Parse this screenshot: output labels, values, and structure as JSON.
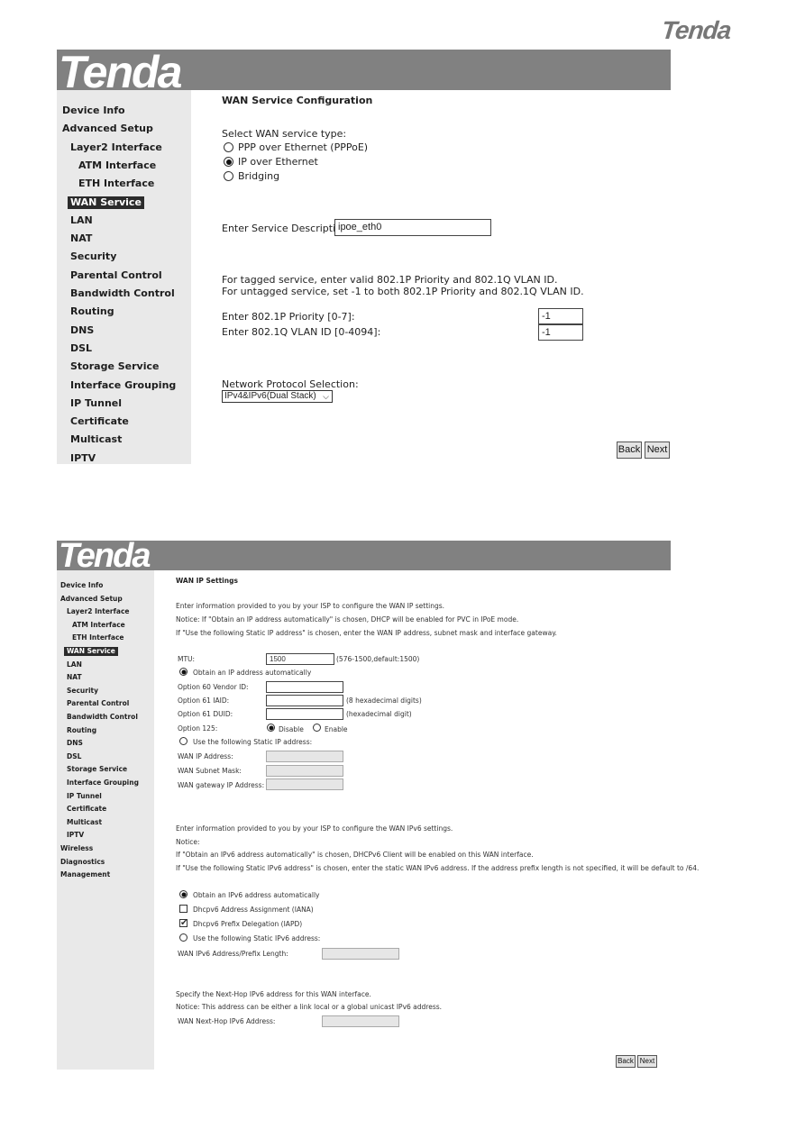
{
  "brand": "Tenda",
  "colors": {
    "banner": "#818181",
    "sidebar": "#e9e9e9",
    "active_nav": "#2b2b2b"
  },
  "screen1": {
    "sidebar": [
      {
        "label": "Device Info",
        "level": 0
      },
      {
        "label": "Advanced Setup",
        "level": 0
      },
      {
        "label": "Layer2 Interface",
        "level": 1
      },
      {
        "label": "ATM Interface",
        "level": 2
      },
      {
        "label": "ETH Interface",
        "level": 2
      },
      {
        "label": "WAN Service",
        "level": 1,
        "active": true
      },
      {
        "label": "LAN",
        "level": 1
      },
      {
        "label": "NAT",
        "level": 1
      },
      {
        "label": "Security",
        "level": 1
      },
      {
        "label": "Parental Control",
        "level": 1
      },
      {
        "label": "Bandwidth Control",
        "level": 1
      },
      {
        "label": "Routing",
        "level": 1
      },
      {
        "label": "DNS",
        "level": 1
      },
      {
        "label": "DSL",
        "level": 1
      },
      {
        "label": "Storage Service",
        "level": 1
      },
      {
        "label": "Interface Grouping",
        "level": 1
      },
      {
        "label": "IP Tunnel",
        "level": 1
      },
      {
        "label": "Certificate",
        "level": 1
      },
      {
        "label": "Multicast",
        "level": 1
      },
      {
        "label": "IPTV",
        "level": 1
      }
    ],
    "title": "WAN Service Configuration",
    "service_type_label": "Select WAN service type:",
    "service_types": [
      {
        "label": "PPP over Ethernet (PPPoE)",
        "selected": false
      },
      {
        "label": "IP over Ethernet",
        "selected": true
      },
      {
        "label": "Bridging",
        "selected": false
      }
    ],
    "service_desc_label": "Enter Service Description:",
    "service_desc_value": "ipoe_eth0",
    "vlan_note_1": "For tagged service, enter valid 802.1P Priority and 802.1Q VLAN ID.",
    "vlan_note_2": "For untagged service, set -1 to both 802.1P Priority and 802.1Q VLAN ID.",
    "priority_label": "Enter 802.1P Priority [0-7]:",
    "priority_value": "-1",
    "vlan_label": "Enter 802.1Q VLAN ID [0-4094]:",
    "vlan_value": "-1",
    "protocol_label": "Network Protocol Selection:",
    "protocol_value": "IPv4&IPv6(Dual Stack)",
    "back": "Back",
    "next": "Next"
  },
  "screen2": {
    "sidebar": [
      {
        "label": "Device Info",
        "level": 0
      },
      {
        "label": "Advanced Setup",
        "level": 0
      },
      {
        "label": "Layer2 Interface",
        "level": 1
      },
      {
        "label": "ATM Interface",
        "level": 2
      },
      {
        "label": "ETH Interface",
        "level": 2
      },
      {
        "label": "WAN Service",
        "level": 1,
        "active": true
      },
      {
        "label": "LAN",
        "level": 1
      },
      {
        "label": "NAT",
        "level": 1
      },
      {
        "label": "Security",
        "level": 1
      },
      {
        "label": "Parental Control",
        "level": 1
      },
      {
        "label": "Bandwidth Control",
        "level": 1
      },
      {
        "label": "Routing",
        "level": 1
      },
      {
        "label": "DNS",
        "level": 1
      },
      {
        "label": "DSL",
        "level": 1
      },
      {
        "label": "Storage Service",
        "level": 1
      },
      {
        "label": "Interface Grouping",
        "level": 1
      },
      {
        "label": "IP Tunnel",
        "level": 1
      },
      {
        "label": "Certificate",
        "level": 1
      },
      {
        "label": "Multicast",
        "level": 1
      },
      {
        "label": "IPTV",
        "level": 1
      },
      {
        "label": "Wireless",
        "level": 0
      },
      {
        "label": "Diagnostics",
        "level": 0
      },
      {
        "label": "Management",
        "level": 0
      }
    ],
    "title": "WAN IP Settings",
    "intro": "Enter information provided to you by your ISP to configure the WAN IP settings.",
    "notice_1": "Notice: If \"Obtain an IP address automatically\" is chosen, DHCP will be enabled for PVC in IPoE mode.",
    "notice_2": "If \"Use the following Static IP address\" is chosen, enter the WAN IP address, subnet mask and interface gateway.",
    "mtu_label": "MTU:",
    "mtu_value": "1500",
    "mtu_hint": "(576-1500,default:1500)",
    "obtain_ip_label": "Obtain an IP address automatically",
    "obtain_ip_selected": true,
    "opt60_label": "Option 60 Vendor ID:",
    "opt60_value": "",
    "opt61_iaid_label": "Option 61 IAID:",
    "opt61_iaid_value": "",
    "opt61_iaid_hint": "(8 hexadecimal digits)",
    "opt61_duid_label": "Option 61 DUID:",
    "opt61_duid_value": "",
    "opt61_duid_hint": "(hexadecimal digit)",
    "opt125_label": "Option 125:",
    "opt125_disable": "Disable",
    "opt125_enable": "Enable",
    "opt125_value": "Disable",
    "static_ip_label": "Use the following Static IP address:",
    "static_ip_selected": false,
    "wan_ip_label": "WAN IP Address:",
    "wan_mask_label": "WAN Subnet Mask:",
    "wan_gw_label": "WAN gateway IP Address:",
    "ipv6_intro": "Enter information provided to you by your ISP to configure the WAN IPv6 settings.",
    "ipv6_notice": "Notice:",
    "ipv6_notice_1": "If \"Obtain an IPv6 address automatically\" is chosen, DHCPv6 Client will be enabled on this WAN interface.",
    "ipv6_notice_2": "If \"Use the following Static IPv6 address\" is chosen, enter the static WAN IPv6 address. If the address prefix length is not specified, it will be default to /64.",
    "obtain_ipv6_label": "Obtain an IPv6 address automatically",
    "obtain_ipv6_selected": true,
    "iana_label": "Dhcpv6 Address Assignment (IANA)",
    "iana_checked": false,
    "iapd_label": "Dhcpv6 Prefix Delegation (IAPD)",
    "iapd_checked": true,
    "static_ipv6_label": "Use the following Static IPv6 address:",
    "static_ipv6_selected": false,
    "ipv6_addr_label": "WAN IPv6 Address/Prefix Length:",
    "nexthop_intro": "Specify the Next-Hop IPv6 address for this WAN interface.",
    "nexthop_notice": "Notice: This address can be either a link local or a global unicast IPv6 address.",
    "nexthop_label": "WAN Next-Hop IPv6 Address:",
    "back": "Back",
    "next": "Next"
  }
}
